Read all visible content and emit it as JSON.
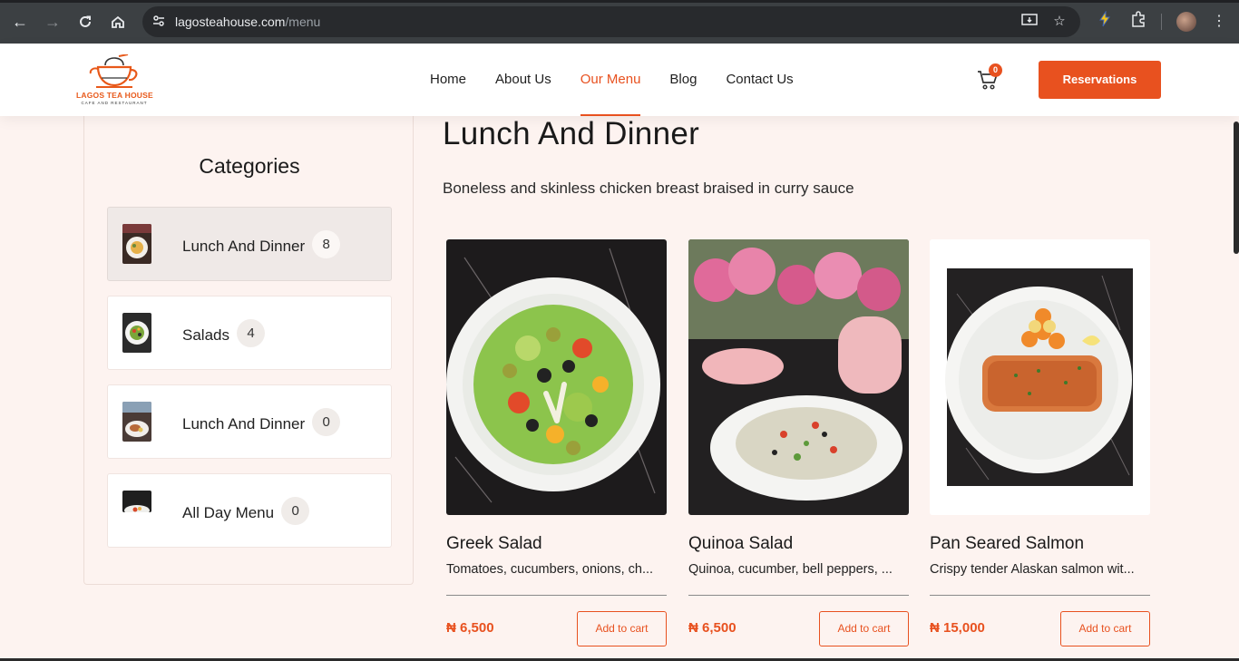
{
  "browser": {
    "url_domain": "lagosteahouse.com",
    "url_path": "/menu"
  },
  "header": {
    "logo_text": "LAGOS TEA HOUSE",
    "logo_sub": "CAFE AND RESTAURANT",
    "nav": [
      {
        "label": "Home",
        "active": false
      },
      {
        "label": "About Us",
        "active": false
      },
      {
        "label": "Our Menu",
        "active": true
      },
      {
        "label": "Blog",
        "active": false
      },
      {
        "label": "Contact Us",
        "active": false
      }
    ],
    "cart_count": "0",
    "reserve_label": "Reservations"
  },
  "sidebar": {
    "title": "Categories",
    "items": [
      {
        "name": "Lunch And Dinner",
        "count": "8",
        "active": true
      },
      {
        "name": "Salads",
        "count": "4",
        "active": false
      },
      {
        "name": "Lunch And Dinner",
        "count": "0",
        "active": false
      },
      {
        "name": "All Day Menu",
        "count": "0",
        "active": false
      }
    ]
  },
  "main": {
    "title": "Lunch And Dinner",
    "description": "Boneless and skinless chicken breast braised in curry sauce",
    "products": [
      {
        "name": "Greek Salad",
        "desc": "Tomatoes, cucumbers, onions, ch...",
        "price": "₦ 6,500",
        "button": "Add to cart"
      },
      {
        "name": "Quinoa Salad",
        "desc": "Quinoa, cucumber, bell peppers, ...",
        "price": "₦ 6,500",
        "button": "Add to cart"
      },
      {
        "name": "Pan Seared Salmon",
        "desc": "Crispy tender Alaskan salmon wit...",
        "price": "₦ 15,000",
        "button": "Add to cart"
      }
    ]
  },
  "colors": {
    "accent": "#e8511f",
    "page_bg": "#fdf3f0",
    "chrome_bg": "#3c4043"
  },
  "icons": [
    "back-icon",
    "forward-icon",
    "reload-icon",
    "home-icon",
    "site-info-icon",
    "install-icon",
    "bookmark-star-icon",
    "extension-icon",
    "puzzle-icon",
    "menu-dots-icon",
    "cart-icon"
  ]
}
